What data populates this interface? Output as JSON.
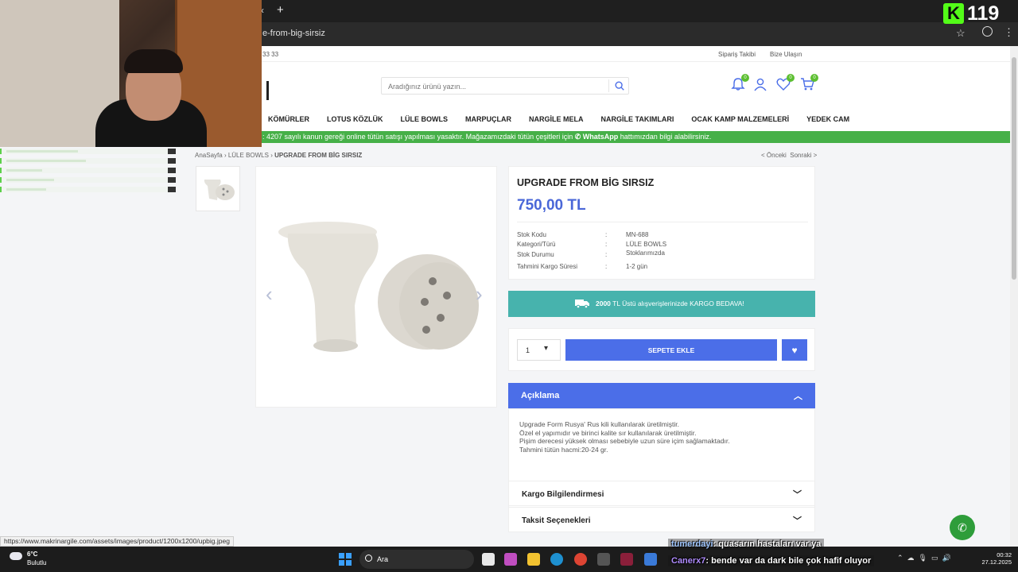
{
  "browser": {
    "url_fragment": "e-from-big-sirsiz",
    "status_url": "https://www.makrinargile.com/assets/images/product/1200x1200/upbig.jpeg"
  },
  "stream": {
    "viewer_count": "119",
    "kick_logo": "K",
    "chat": [
      {
        "user": "tumerdayi",
        "message": ": quasarın hastaları var ya"
      },
      {
        "user": "Canerx7",
        "message": ": bende var da dark bile çok hafif oluyor"
      }
    ]
  },
  "site": {
    "topbar": {
      "phone_fragment": "33 33",
      "order_tracking": "Sipariş Takibi",
      "contact": "Bize Ulaşın"
    },
    "search": {
      "placeholder": "Aradığınız ürünü yazın..."
    },
    "header_icons": {
      "notifications_count": "0",
      "favorites_count": "0",
      "cart_count": "0"
    },
    "nav": [
      "KÖMÜRLER",
      "LOTUS KÖZLÜK",
      "LÜLE BOWLS",
      "MARPUÇLAR",
      "NARGİLE MELA",
      "NARGİLE TAKIMLARI",
      "OCAK KAMP MALZEMELERİ",
      "YEDEK CAM"
    ],
    "announcement": {
      "text_before": ": 4207 sayılı kanun gereği online tütün satışı yapılması yasaktır. Mağazamızdaki tütün çeşitleri için",
      "whatsapp": "WhatsApp",
      "text_after": "hattımızdan bilgi alabilirsiniz."
    },
    "breadcrumb": {
      "home": "AnaSayfa",
      "category": "LÜLE BOWLS",
      "current": "UPGRADE FROM BİG SIRSIZ"
    },
    "pager": {
      "prev": "< Önceki",
      "next": "Sonraki >"
    },
    "product": {
      "title": "UPGRADE FROM BİG SIRSIZ",
      "price": "750,00 TL",
      "specs": [
        {
          "key": "Stok Kodu",
          "value": "MN-688"
        },
        {
          "key": "Kategori/Türü",
          "value": "LÜLE BOWLS"
        },
        {
          "key": "Stok Durumu",
          "value": "Stoklarımızda"
        },
        {
          "key": "Tahmini Kargo Süresi",
          "value": "1-2 gün"
        }
      ],
      "cargo_amount": "2000",
      "cargo_text": "TL Üstü alışverişlerinizde KARGO BEDAVA!",
      "quantity": "1",
      "add_to_cart": "SEPETE EKLE",
      "description_title": "Açıklama",
      "description": [
        "Upgrade Form Rusya' Rus kili kullanılarak üretilmiştir.",
        "Özel el yapımıdır ve birinci kalite sır kullanılarak üretilmiştir.",
        "Pişim derecesi yüksek olması sebebiyle uzun süre içim sağlamaktadır.",
        "Tahmini tütün hacmi:20-24 gr."
      ],
      "shipping_info": "Kargo Bilgilendirmesi",
      "installments": "Taksit Seçenekleri"
    }
  },
  "taskbar": {
    "temperature": "6°C",
    "weather": "Bulutlu",
    "search": "Ara",
    "time": "00:32",
    "date": "27.12.2025"
  },
  "colors": {
    "primary": "#4b6ee8",
    "announce_green": "#46b048",
    "cargo_teal": "#47b3ad",
    "kick_green": "#53fc18"
  }
}
